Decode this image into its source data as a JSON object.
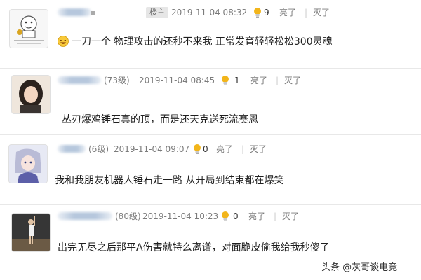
{
  "owner_badge": "楼主",
  "actions": {
    "like": "亮了",
    "dislike": "灭了"
  },
  "comments": [
    {
      "level": "",
      "time": "2019-11-04 08:32",
      "likes": "9",
      "text": "一刀一个 物理攻击的还秒不来我 正常发育轻轻松松300灵魂",
      "has_emoji": true
    },
    {
      "level": "(73级)",
      "time": "2019-11-04 08:45",
      "likes": "1",
      "text": "丛刃爆鸡锤石真的顶，而是还天克送死流赛恩"
    },
    {
      "level": "(6级)",
      "time": "2019-11-04 09:07",
      "likes": "0",
      "text": "我和我朋友机器人锤石走一路 从开局到结束都在爆笑"
    },
    {
      "level": "(80级)",
      "time": "2019-11-04 10:23",
      "likes": "0",
      "text": "出完无尽之后那平A伤害就特么离谱，对面脆皮偷我给我秒傻了"
    }
  ],
  "watermark": "头条 @灰哥谈电竞",
  "colors": {
    "bulb": "#f2b51b",
    "meta_text": "#7b7b7b",
    "separator": "#e8e8e8"
  },
  "icons": [
    "lightbulb-icon",
    "laughing-emoji-icon"
  ]
}
